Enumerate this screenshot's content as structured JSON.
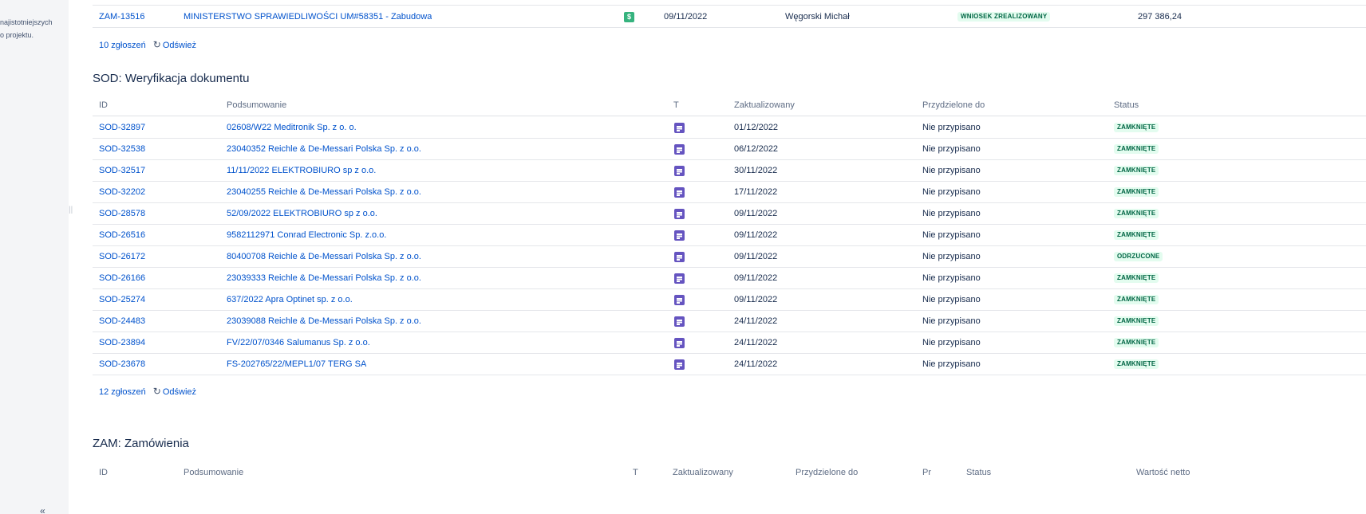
{
  "sidebar": {
    "text_line1": "najistotniejszych",
    "text_line2": "o projektu.",
    "collapse_glyph": "«"
  },
  "top_table": {
    "partial_status": "",
    "row": {
      "id": "ZAM-13516",
      "summary": "MINISTERSTWO SPRAWIEDLIWOŚCI UM#58351 - Zabudowa",
      "type_icon": "money-icon",
      "updated": "09/11/2022",
      "assignee": "Węgorski Michał",
      "status": "WNIOSEK ZREALIZOWANY",
      "value": "297 386,24"
    },
    "footer": {
      "count": "10 zgłoszeń",
      "refresh": "Odśwież"
    }
  },
  "sod": {
    "title": "SOD: Weryfikacja dokumentu",
    "columns": {
      "id": "ID",
      "summary": "Podsumowanie",
      "type": "T",
      "updated": "Zaktualizowany",
      "assignee": "Przydzielone do",
      "status": "Status"
    },
    "rows": [
      {
        "id": "SOD-32897",
        "summary": "02608/W22 Meditronik Sp. z o. o.",
        "updated": "01/12/2022",
        "assignee": "Nie przypisano",
        "status": "ZAMKNIĘTE"
      },
      {
        "id": "SOD-32538",
        "summary": "23040352 Reichle & De-Messari Polska Sp. z o.o.",
        "updated": "06/12/2022",
        "assignee": "Nie przypisano",
        "status": "ZAMKNIĘTE"
      },
      {
        "id": "SOD-32517",
        "summary": "11/11/2022 ELEKTROBIURO sp z o.o.",
        "updated": "30/11/2022",
        "assignee": "Nie przypisano",
        "status": "ZAMKNIĘTE"
      },
      {
        "id": "SOD-32202",
        "summary": "23040255 Reichle & De-Messari Polska Sp. z o.o.",
        "updated": "17/11/2022",
        "assignee": "Nie przypisano",
        "status": "ZAMKNIĘTE"
      },
      {
        "id": "SOD-28578",
        "summary": "52/09/2022 ELEKTROBIURO sp z o.o.",
        "updated": "09/11/2022",
        "assignee": "Nie przypisano",
        "status": "ZAMKNIĘTE"
      },
      {
        "id": "SOD-26516",
        "summary": "9582112971 Conrad Electronic Sp. z.o.o.",
        "updated": "09/11/2022",
        "assignee": "Nie przypisano",
        "status": "ZAMKNIĘTE"
      },
      {
        "id": "SOD-26172",
        "summary": "80400708 Reichle & De-Messari Polska Sp. z o.o.",
        "updated": "09/11/2022",
        "assignee": "Nie przypisano",
        "status": "ODRZUCONE"
      },
      {
        "id": "SOD-26166",
        "summary": "23039333 Reichle & De-Messari Polska Sp. z o.o.",
        "updated": "09/11/2022",
        "assignee": "Nie przypisano",
        "status": "ZAMKNIĘTE"
      },
      {
        "id": "SOD-25274",
        "summary": "637/2022 Apra Optinet sp. z o.o.",
        "updated": "09/11/2022",
        "assignee": "Nie przypisano",
        "status": "ZAMKNIĘTE"
      },
      {
        "id": "SOD-24483",
        "summary": "23039088 Reichle & De-Messari Polska Sp. z o.o.",
        "updated": "24/11/2022",
        "assignee": "Nie przypisano",
        "status": "ZAMKNIĘTE"
      },
      {
        "id": "SOD-23894",
        "summary": "FV/22/07/0346 Salumanus Sp. z o.o.",
        "updated": "24/11/2022",
        "assignee": "Nie przypisano",
        "status": "ZAMKNIĘTE"
      },
      {
        "id": "SOD-23678",
        "summary": "FS-202765/22/MEPL1/07 TERG SA",
        "updated": "24/11/2022",
        "assignee": "Nie przypisano",
        "status": "ZAMKNIĘTE"
      }
    ],
    "footer": {
      "count": "12 zgłoszeń",
      "refresh": "Odśwież"
    }
  },
  "zam": {
    "title": "ZAM: Zamówienia",
    "columns": {
      "id": "ID",
      "summary": "Podsumowanie",
      "type": "T",
      "updated": "Zaktualizowany",
      "assignee": "Przydzielone do",
      "priority": "Pr",
      "status": "Status",
      "value": "Wartość netto"
    }
  },
  "colors": {
    "link": "#0052cc",
    "status_green_bg": "#e3fcef",
    "status_green_text": "#006644",
    "type_icon_purple": "#6554c0",
    "money_icon_green": "#36b37e"
  }
}
